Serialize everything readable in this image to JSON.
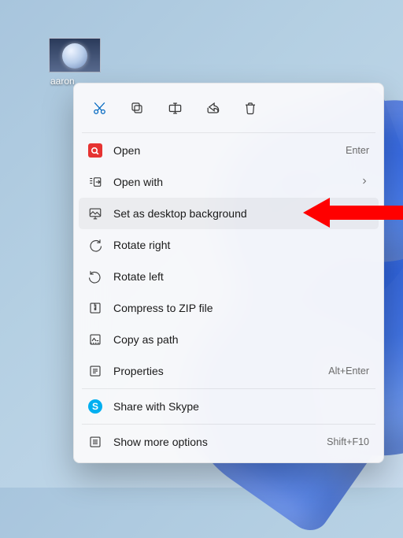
{
  "desktop": {
    "icon_label": "aaron"
  },
  "quick_actions": {
    "cut": "cut-icon",
    "copy": "copy-icon",
    "rename": "rename-icon",
    "share": "share-icon",
    "delete": "delete-icon"
  },
  "menu": {
    "open": {
      "label": "Open",
      "accel": "Enter"
    },
    "open_with": {
      "label": "Open with"
    },
    "set_bg": {
      "label": "Set as desktop background"
    },
    "rotate_right": {
      "label": "Rotate right"
    },
    "rotate_left": {
      "label": "Rotate left"
    },
    "compress": {
      "label": "Compress to ZIP file"
    },
    "copy_path": {
      "label": "Copy as path"
    },
    "properties": {
      "label": "Properties",
      "accel": "Alt+Enter"
    },
    "share_skype": {
      "label": "Share with Skype"
    },
    "more": {
      "label": "Show more options",
      "accel": "Shift+F10"
    }
  },
  "annotation": {
    "arrow_color": "#ff0000",
    "points_to": "set_bg"
  }
}
